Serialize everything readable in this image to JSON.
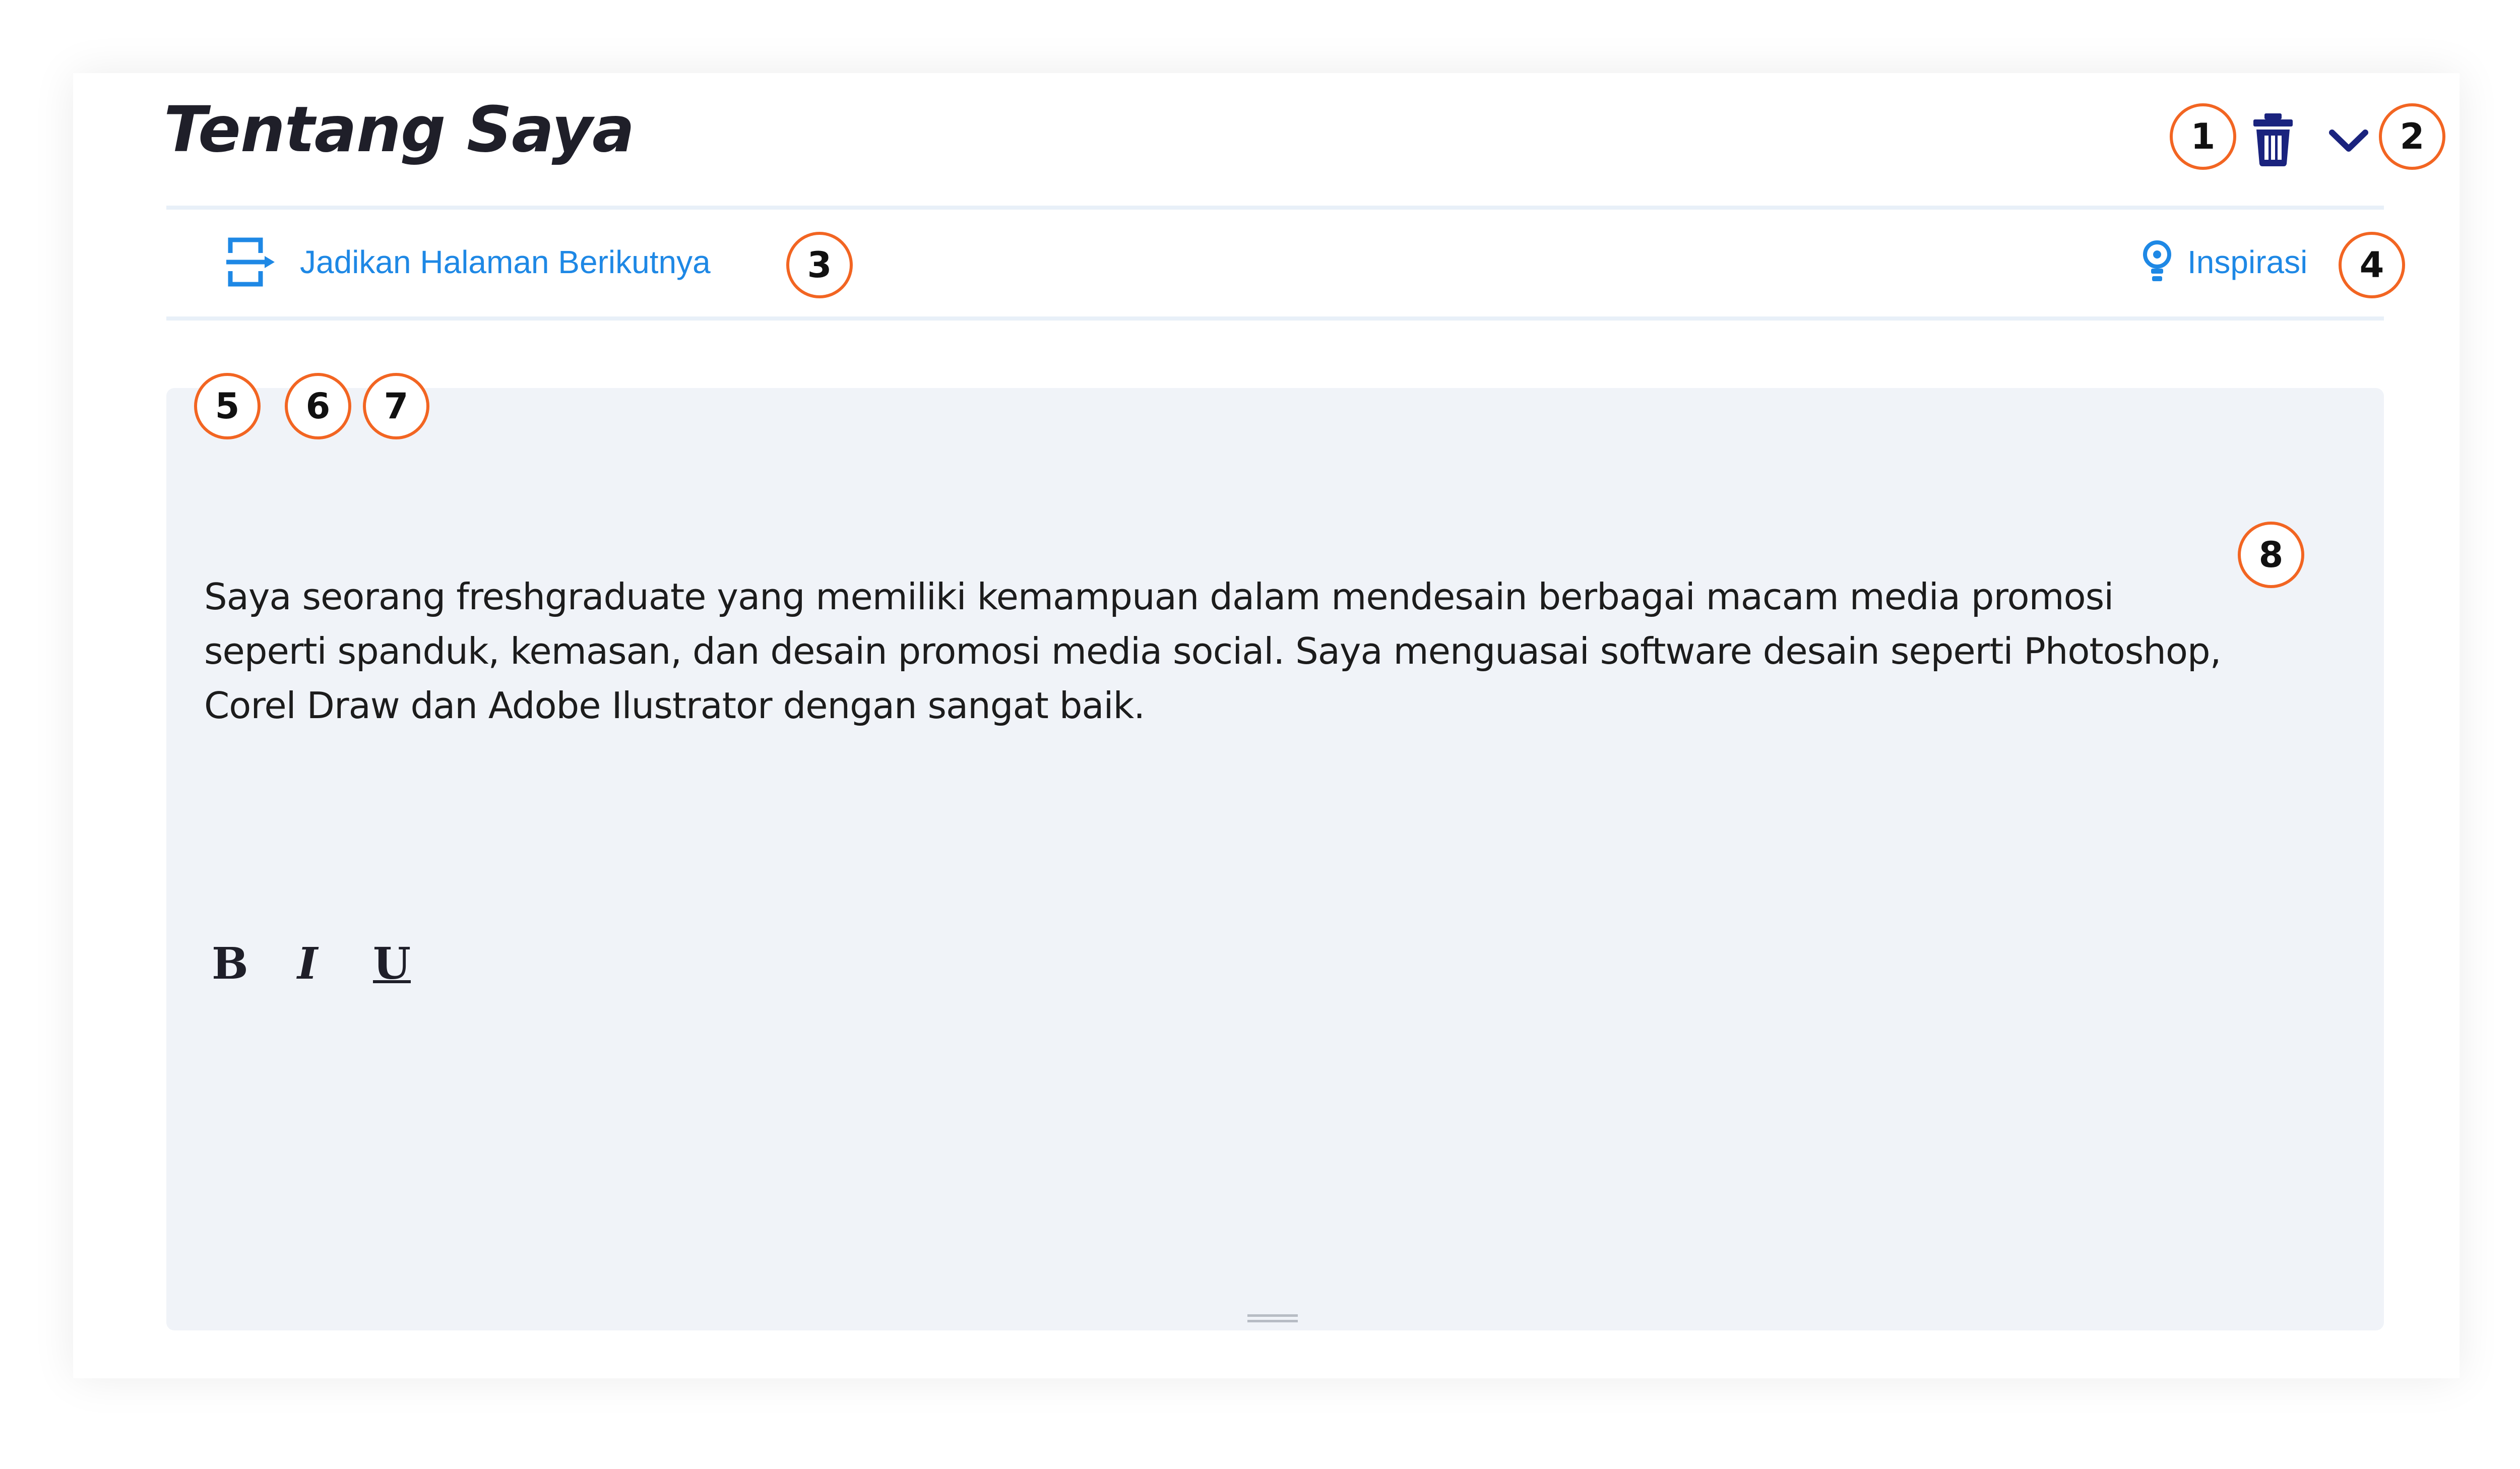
{
  "section": {
    "title": "Tentang Saya",
    "delete_icon": "trash-icon",
    "collapse_icon": "chevron-down-icon"
  },
  "toolbar": {
    "next_page_label": "Jadikan Halaman Berikutnya",
    "next_page_icon": "page-break-icon",
    "inspiration_label": "Inspirasi",
    "inspiration_icon": "lightbulb-icon"
  },
  "editor": {
    "format_buttons": [
      {
        "label": "B",
        "name": "bold"
      },
      {
        "label": "I",
        "name": "italic"
      },
      {
        "label": "U",
        "name": "underline"
      }
    ],
    "text_lines": [
      "Saya seorang freshgraduate yang memiliki kemampuan dalam mendesain berbagai macam media promosi",
      "seperti spanduk, kemasan, dan desain promosi media social. Saya menguasai software desain seperti Photoshop,",
      "Corel Draw dan Adobe Ilustrator dengan sangat baik."
    ]
  },
  "callouts": [
    "1",
    "2",
    "3",
    "4",
    "5",
    "6",
    "7",
    "8"
  ],
  "colors": {
    "link": "#1e88e5",
    "icon_dark": "#1a237e",
    "callout_border": "#f26522",
    "editor_bg": "#f0f3f8",
    "divider": "#e8f0f8"
  }
}
